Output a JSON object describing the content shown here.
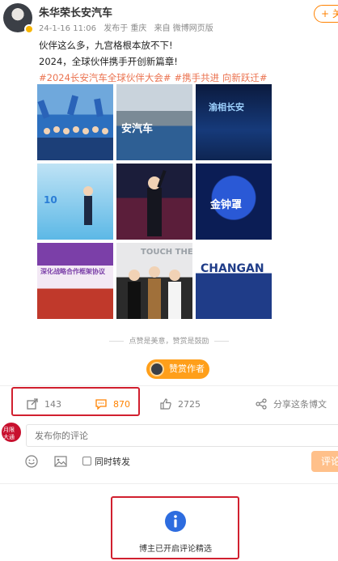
{
  "post": {
    "author": "朱华荣长安汽车",
    "date": "24-1-16 11:06",
    "location": "发布于 重庆",
    "source": "来自 微博网页版",
    "follow_label": "+ 关",
    "line1": "伙伴这么多，九宫格根本放不下!",
    "line2": "2024，全球伙伴携手开创新篇章!",
    "topics": [
      "#2024长安汽车全球伙伴大会#",
      "#携手共进 向新跃迁#"
    ],
    "images": [
      {
        "name": "group-photo-1"
      },
      {
        "name": "group-photo-2",
        "text": "安汽车"
      },
      {
        "name": "stage-photo-1",
        "text": "渝相长安"
      },
      {
        "name": "stage-photo-2",
        "text": "10"
      },
      {
        "name": "selfie-photo"
      },
      {
        "name": "stage-photo-3",
        "text": "金钟罩"
      },
      {
        "name": "signing-photo",
        "text": "深化战略合作框架协议"
      },
      {
        "name": "three-women-photo",
        "text": "TOUCH THE"
      },
      {
        "name": "changan-photo",
        "text": "CHANGAN"
      }
    ]
  },
  "support": {
    "hint": "点赞是美意，赞赏是鼓励",
    "reward_label": "赞赏作者"
  },
  "actions": {
    "repost_count": "143",
    "comment_count": "870",
    "like_count": "2725",
    "share_label": "分享这条博文"
  },
  "comment": {
    "placeholder": "发布你的评论",
    "repost_label": "同时转发",
    "submit_label": "评论",
    "avatar_text": "月限大通"
  },
  "notice": {
    "text": "博主已开启评论精选"
  },
  "colors": {
    "accent": "#ff8200",
    "topic": "#eb7350",
    "highlight": "#d1202f",
    "info": "#2d6cdf"
  }
}
